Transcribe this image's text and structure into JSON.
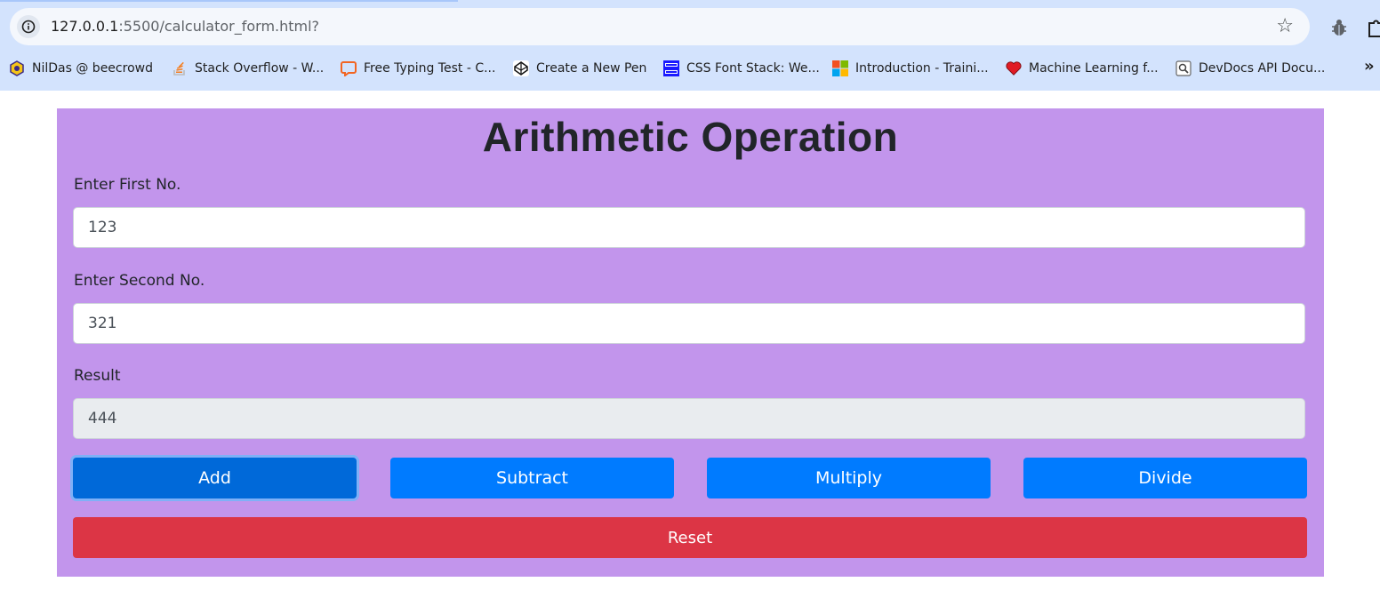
{
  "browser": {
    "url_host": "127.0.0.1",
    "url_rest": ":5500/calculator_form.html?",
    "bookmarks": [
      {
        "label": "NilDas @ beecrowd",
        "icon": "beecrowd-icon"
      },
      {
        "label": "Stack Overflow - W...",
        "icon": "stackoverflow-icon"
      },
      {
        "label": "Free Typing Test - C...",
        "icon": "typing-test-icon"
      },
      {
        "label": "Create a New Pen",
        "icon": "codepen-icon"
      },
      {
        "label": "CSS Font Stack: We...",
        "icon": "cssfontstack-icon"
      },
      {
        "label": "Introduction - Traini...",
        "icon": "microsoft-icon"
      },
      {
        "label": "Machine Learning f...",
        "icon": "heart-icon"
      },
      {
        "label": "DevDocs API Docu...",
        "icon": "devdocs-icon"
      }
    ],
    "more_label": "»"
  },
  "form": {
    "title": "Arithmetic Operation",
    "first_label": "Enter First No.",
    "first_value": "123",
    "second_label": "Enter Second No.",
    "second_value": "321",
    "result_label": "Result",
    "result_value": "444",
    "buttons": {
      "add": "Add",
      "subtract": "Subtract",
      "multiply": "Multiply",
      "divide": "Divide",
      "reset": "Reset"
    }
  },
  "colors": {
    "card_bg": "#c295ec",
    "primary": "#007bff",
    "primary_active": "#0069d9",
    "danger": "#dc3545"
  }
}
